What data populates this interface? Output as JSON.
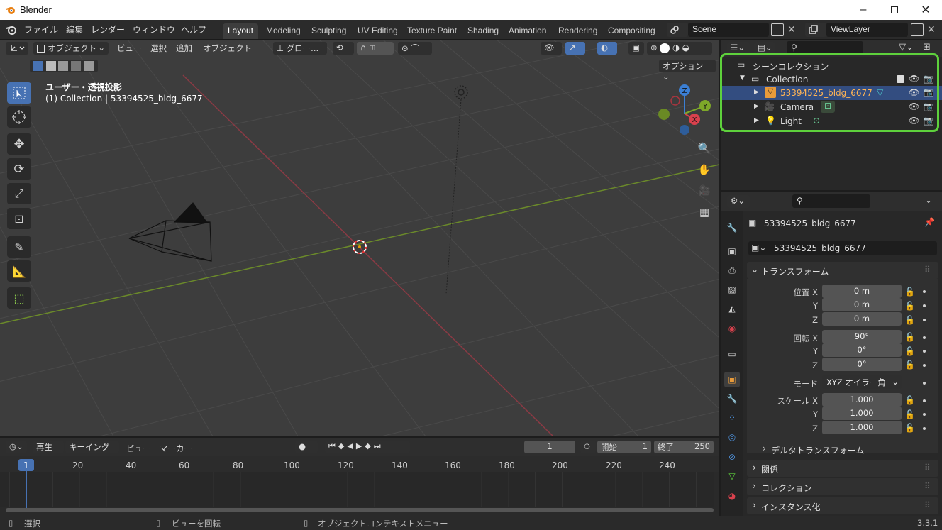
{
  "app": {
    "title": "Blender",
    "version": "3.3.1"
  },
  "menu": [
    "ファイル",
    "編集",
    "レンダー",
    "ウィンドウ",
    "ヘルプ"
  ],
  "workspaces": [
    "Layout",
    "Modeling",
    "Sculpting",
    "UV Editing",
    "Texture Paint",
    "Shading",
    "Animation",
    "Rendering",
    "Compositing"
  ],
  "scene": {
    "name": "Scene",
    "view_layer": "ViewLayer"
  },
  "viewport": {
    "mode": "オブジェクト",
    "menus": [
      "ビュー",
      "選択",
      "追加",
      "オブジェクト"
    ],
    "transform_orientation": "グロー...",
    "options_label": "オプション",
    "view_name": "ユーザー・透視投影",
    "context": "(1) Collection | 53394525_bldg_6677",
    "gizmo_axes": [
      "X",
      "Y",
      "Z"
    ]
  },
  "timeline": {
    "playback": "再生",
    "keying": "キーイング",
    "view": "ビュー",
    "marker": "マーカー",
    "current_frame": "1",
    "start_label": "開始",
    "start": "1",
    "end_label": "終了",
    "end": "250",
    "ticks": [
      "1",
      "20",
      "40",
      "60",
      "80",
      "100",
      "120",
      "140",
      "160",
      "180",
      "200",
      "220",
      "240"
    ]
  },
  "outliner": {
    "root": "シーンコレクション",
    "collection": "Collection",
    "items": [
      "53394525_bldg_6677",
      "Camera",
      "Light"
    ]
  },
  "properties": {
    "object_name": "53394525_bldg_6677",
    "datablock_name": "53394525_bldg_6677",
    "transform_label": "トランスフォーム",
    "location_label": "位置 X",
    "rotation_label": "回転 X",
    "scale_label": "スケール X",
    "mode_label": "モード",
    "y": "Y",
    "z": "Z",
    "location": [
      "0 m",
      "0 m",
      "0 m"
    ],
    "rotation": [
      "90°",
      "0°",
      "0°"
    ],
    "rotation_mode": "XYZ オイラー角",
    "scale": [
      "1.000",
      "1.000",
      "1.000"
    ],
    "delta_label": "デルタトランスフォーム",
    "sections": [
      "関係",
      "コレクション",
      "インスタンス化"
    ]
  },
  "status": {
    "select": "選択",
    "rotate": "ビューを回転",
    "context_menu": "オブジェクトコンテキストメニュー"
  },
  "colors": {
    "accent": "#4772b3",
    "highlight": "#5ed13c",
    "selected_row": "#334d80",
    "object_orange": "#e89b3b"
  }
}
